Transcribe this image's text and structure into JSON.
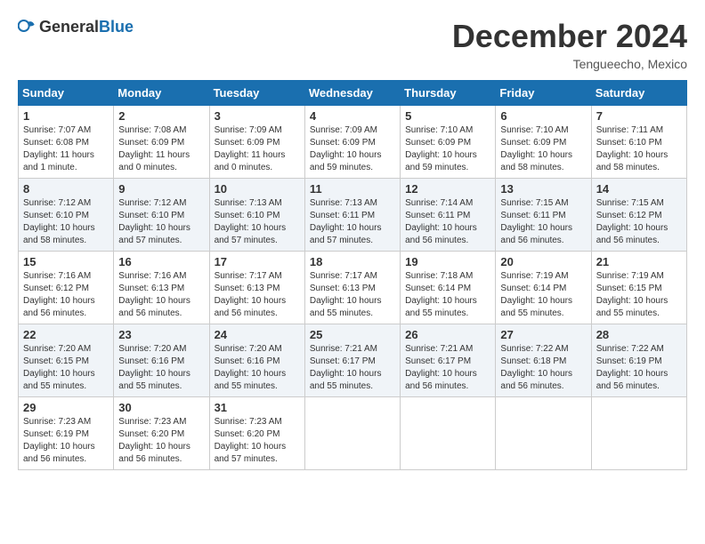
{
  "header": {
    "logo_general": "General",
    "logo_blue": "Blue",
    "month_title": "December 2024",
    "location": "Tengueecho, Mexico"
  },
  "calendar": {
    "days_of_week": [
      "Sunday",
      "Monday",
      "Tuesday",
      "Wednesday",
      "Thursday",
      "Friday",
      "Saturday"
    ],
    "weeks": [
      [
        {
          "day": "",
          "empty": true
        },
        {
          "day": "",
          "empty": true
        },
        {
          "day": "",
          "empty": true
        },
        {
          "day": "",
          "empty": true
        },
        {
          "day": "",
          "empty": true
        },
        {
          "day": "",
          "empty": true
        },
        {
          "day": "",
          "empty": true
        }
      ],
      [
        {
          "day": "1",
          "sunrise": "7:07 AM",
          "sunset": "6:08 PM",
          "daylight": "11 hours and 1 minute."
        },
        {
          "day": "2",
          "sunrise": "7:08 AM",
          "sunset": "6:09 PM",
          "daylight": "11 hours and 0 minutes."
        },
        {
          "day": "3",
          "sunrise": "7:09 AM",
          "sunset": "6:09 PM",
          "daylight": "11 hours and 0 minutes."
        },
        {
          "day": "4",
          "sunrise": "7:09 AM",
          "sunset": "6:09 PM",
          "daylight": "10 hours and 59 minutes."
        },
        {
          "day": "5",
          "sunrise": "7:10 AM",
          "sunset": "6:09 PM",
          "daylight": "10 hours and 59 minutes."
        },
        {
          "day": "6",
          "sunrise": "7:10 AM",
          "sunset": "6:09 PM",
          "daylight": "10 hours and 58 minutes."
        },
        {
          "day": "7",
          "sunrise": "7:11 AM",
          "sunset": "6:10 PM",
          "daylight": "10 hours and 58 minutes."
        }
      ],
      [
        {
          "day": "8",
          "sunrise": "7:12 AM",
          "sunset": "6:10 PM",
          "daylight": "10 hours and 58 minutes."
        },
        {
          "day": "9",
          "sunrise": "7:12 AM",
          "sunset": "6:10 PM",
          "daylight": "10 hours and 57 minutes."
        },
        {
          "day": "10",
          "sunrise": "7:13 AM",
          "sunset": "6:10 PM",
          "daylight": "10 hours and 57 minutes."
        },
        {
          "day": "11",
          "sunrise": "7:13 AM",
          "sunset": "6:11 PM",
          "daylight": "10 hours and 57 minutes."
        },
        {
          "day": "12",
          "sunrise": "7:14 AM",
          "sunset": "6:11 PM",
          "daylight": "10 hours and 56 minutes."
        },
        {
          "day": "13",
          "sunrise": "7:15 AM",
          "sunset": "6:11 PM",
          "daylight": "10 hours and 56 minutes."
        },
        {
          "day": "14",
          "sunrise": "7:15 AM",
          "sunset": "6:12 PM",
          "daylight": "10 hours and 56 minutes."
        }
      ],
      [
        {
          "day": "15",
          "sunrise": "7:16 AM",
          "sunset": "6:12 PM",
          "daylight": "10 hours and 56 minutes."
        },
        {
          "day": "16",
          "sunrise": "7:16 AM",
          "sunset": "6:13 PM",
          "daylight": "10 hours and 56 minutes."
        },
        {
          "day": "17",
          "sunrise": "7:17 AM",
          "sunset": "6:13 PM",
          "daylight": "10 hours and 56 minutes."
        },
        {
          "day": "18",
          "sunrise": "7:17 AM",
          "sunset": "6:13 PM",
          "daylight": "10 hours and 55 minutes."
        },
        {
          "day": "19",
          "sunrise": "7:18 AM",
          "sunset": "6:14 PM",
          "daylight": "10 hours and 55 minutes."
        },
        {
          "day": "20",
          "sunrise": "7:19 AM",
          "sunset": "6:14 PM",
          "daylight": "10 hours and 55 minutes."
        },
        {
          "day": "21",
          "sunrise": "7:19 AM",
          "sunset": "6:15 PM",
          "daylight": "10 hours and 55 minutes."
        }
      ],
      [
        {
          "day": "22",
          "sunrise": "7:20 AM",
          "sunset": "6:15 PM",
          "daylight": "10 hours and 55 minutes."
        },
        {
          "day": "23",
          "sunrise": "7:20 AM",
          "sunset": "6:16 PM",
          "daylight": "10 hours and 55 minutes."
        },
        {
          "day": "24",
          "sunrise": "7:20 AM",
          "sunset": "6:16 PM",
          "daylight": "10 hours and 55 minutes."
        },
        {
          "day": "25",
          "sunrise": "7:21 AM",
          "sunset": "6:17 PM",
          "daylight": "10 hours and 55 minutes."
        },
        {
          "day": "26",
          "sunrise": "7:21 AM",
          "sunset": "6:17 PM",
          "daylight": "10 hours and 56 minutes."
        },
        {
          "day": "27",
          "sunrise": "7:22 AM",
          "sunset": "6:18 PM",
          "daylight": "10 hours and 56 minutes."
        },
        {
          "day": "28",
          "sunrise": "7:22 AM",
          "sunset": "6:19 PM",
          "daylight": "10 hours and 56 minutes."
        }
      ],
      [
        {
          "day": "29",
          "sunrise": "7:23 AM",
          "sunset": "6:19 PM",
          "daylight": "10 hours and 56 minutes."
        },
        {
          "day": "30",
          "sunrise": "7:23 AM",
          "sunset": "6:20 PM",
          "daylight": "10 hours and 56 minutes."
        },
        {
          "day": "31",
          "sunrise": "7:23 AM",
          "sunset": "6:20 PM",
          "daylight": "10 hours and 57 minutes."
        },
        {
          "day": "",
          "empty": true
        },
        {
          "day": "",
          "empty": true
        },
        {
          "day": "",
          "empty": true
        },
        {
          "day": "",
          "empty": true
        }
      ]
    ]
  }
}
